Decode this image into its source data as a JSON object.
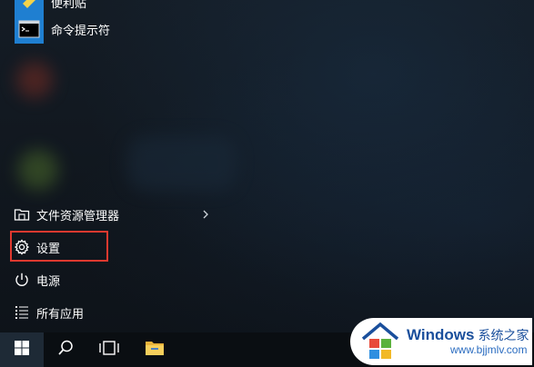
{
  "start_menu": {
    "apps": [
      {
        "label": "便利贴"
      },
      {
        "label": "命令提示符"
      }
    ],
    "items": [
      {
        "label": "文件资源管理器"
      },
      {
        "label": "设置"
      },
      {
        "label": "电源"
      },
      {
        "label": "所有应用"
      }
    ]
  },
  "taskbar": {
    "buttons": [
      "start-icon",
      "search-icon",
      "task-view-icon",
      "file-explorer-icon"
    ]
  },
  "watermark": {
    "title": "Windows",
    "subtitle": "系统之家",
    "url": "www.bjjmlv.com"
  },
  "colors": {
    "accent": "#1f7fd1",
    "highlight": "#e0392f",
    "taskbar": "#0a0e12"
  }
}
